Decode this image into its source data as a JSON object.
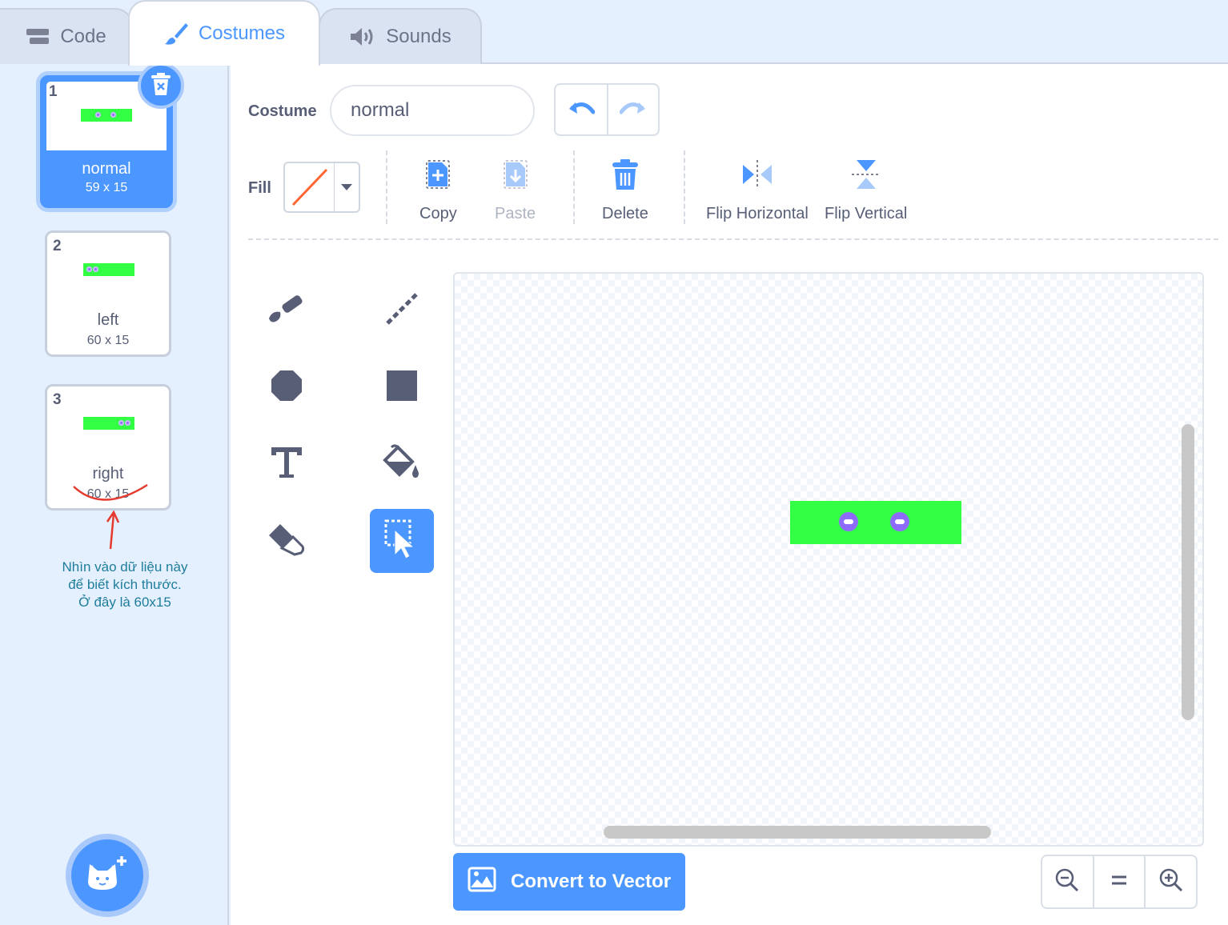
{
  "tabs": [
    {
      "label": "Code",
      "icon": "code-icon"
    },
    {
      "label": "Costumes",
      "icon": "brush-icon",
      "active": true
    },
    {
      "label": "Sounds",
      "icon": "speaker-icon"
    }
  ],
  "costumes": [
    {
      "number": "1",
      "name": "normal",
      "size": "59 x 15",
      "selected": true
    },
    {
      "number": "2",
      "name": "left",
      "size": "60 x 15"
    },
    {
      "number": "3",
      "name": "right",
      "size": "60 x 15"
    }
  ],
  "annotation": {
    "line1": "Nhìn vào dữ liệu này",
    "line2": "để biết kích thước.",
    "line3": "Ở đây là 60x15",
    "color": "#1e7d9c"
  },
  "editor": {
    "costume_label": "Costume",
    "costume_name": "normal",
    "fill_label": "Fill",
    "fill_color": "#ff6633",
    "actions": {
      "copy": "Copy",
      "paste": "Paste",
      "delete": "Delete",
      "flip_horizontal": "Flip Horizontal",
      "flip_vertical": "Flip Vertical"
    },
    "tools": [
      "brush-tool",
      "line-tool",
      "circle-tool",
      "rectangle-tool",
      "text-tool",
      "fill-tool",
      "eraser-tool",
      "select-tool"
    ],
    "active_tool": "select-tool",
    "convert_button": "Convert to Vector"
  },
  "colors": {
    "accent": "#4c97ff",
    "sprite_green": "#33ff44",
    "sprite_eye": "#8e6bff"
  }
}
